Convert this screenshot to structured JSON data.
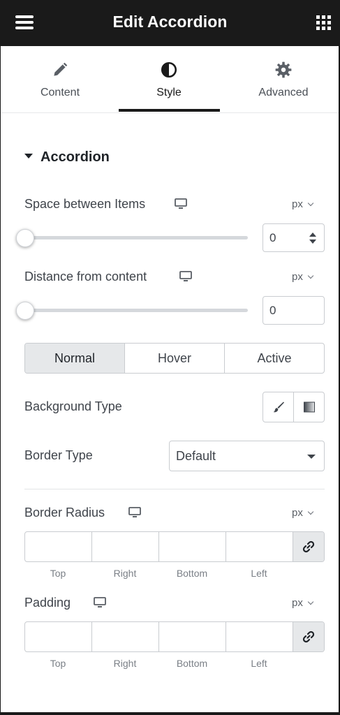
{
  "header": {
    "title": "Edit Accordion",
    "menu_icon": "hamburger-icon",
    "apps_icon": "grid-icon"
  },
  "tabs": [
    {
      "label": "Content",
      "icon": "pencil-icon"
    },
    {
      "label": "Style",
      "icon": "half-circle-icon",
      "active": true
    },
    {
      "label": "Advanced",
      "icon": "gear-icon"
    }
  ],
  "section": {
    "title": "Accordion"
  },
  "space_between": {
    "label": "Space between Items",
    "unit": "px",
    "value": "0"
  },
  "distance": {
    "label": "Distance from content",
    "unit": "px",
    "value": "0"
  },
  "state_tabs": {
    "items": [
      "Normal",
      "Hover",
      "Active"
    ],
    "selected": "Normal"
  },
  "background_type": {
    "label": "Background Type"
  },
  "border_type": {
    "label": "Border Type",
    "value": "Default"
  },
  "border_radius": {
    "label": "Border Radius",
    "unit": "px",
    "sides": [
      "Top",
      "Right",
      "Bottom",
      "Left"
    ]
  },
  "padding": {
    "label": "Padding",
    "unit": "px",
    "sides": [
      "Top",
      "Right",
      "Bottom",
      "Left"
    ]
  },
  "colors": {
    "header_bg": "#1a1a1a",
    "active_segment": "#e6e8ea",
    "text": "#3f444b"
  }
}
